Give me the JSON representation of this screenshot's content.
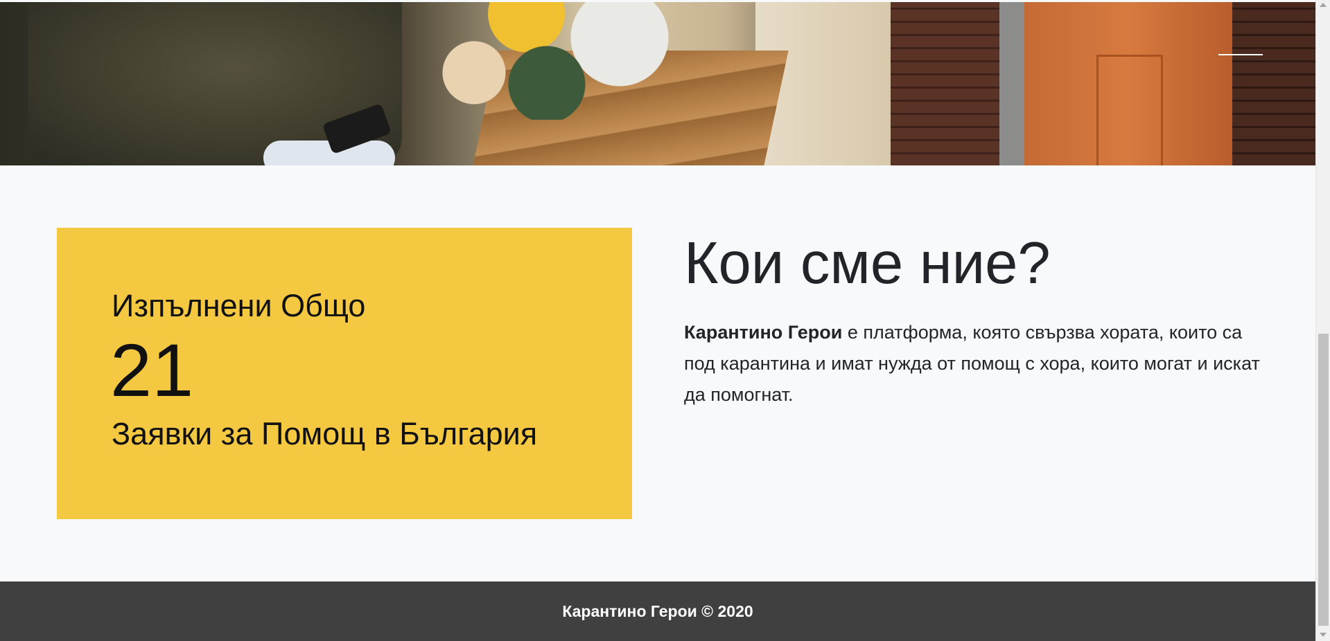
{
  "hero": {
    "image_icon": "hero-photo-icon",
    "menu_icon": "menu-line-icon"
  },
  "stats": {
    "label": "Изпълнени Общо",
    "count": "21",
    "subtitle": "Заявки за Помощ в България",
    "background_color": "#f5c842"
  },
  "about": {
    "heading": "Кои сме ние?",
    "brand": "Карантино Герои",
    "description": " е платформа, която свързва хората, които са под карантина и имат нужда от помощ с хора, които могат и искат да помогнат."
  },
  "footer": {
    "copyright": "Карантино Герои © 2020",
    "background_color": "#404040"
  }
}
